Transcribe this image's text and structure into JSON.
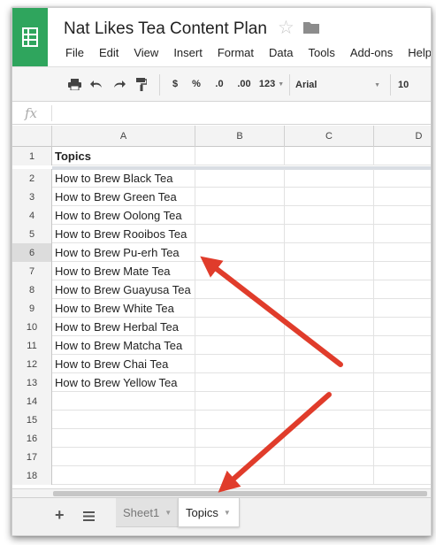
{
  "header": {
    "title": "Nat Likes Tea Content Plan",
    "menu": [
      "File",
      "Edit",
      "View",
      "Insert",
      "Format",
      "Data",
      "Tools",
      "Add-ons",
      "Help"
    ]
  },
  "toolbar": {
    "currency": "$",
    "percent": "%",
    "decrease_decimals": ".0",
    "increase_decimals": ".00",
    "more_formats": "123",
    "font": "Arial",
    "font_size": "10"
  },
  "formula_bar": {
    "fx": "fx",
    "value": ""
  },
  "grid": {
    "columns": [
      "A",
      "B",
      "C",
      "D"
    ],
    "rows": [
      {
        "num": "1",
        "a": "Topics"
      },
      {
        "num": "2",
        "a": "How to Brew Black Tea"
      },
      {
        "num": "3",
        "a": "How to Brew Green Tea"
      },
      {
        "num": "4",
        "a": "How to Brew Oolong Tea"
      },
      {
        "num": "5",
        "a": "How to Brew Rooibos Tea"
      },
      {
        "num": "6",
        "a": "How to Brew Pu-erh Tea"
      },
      {
        "num": "7",
        "a": "How to Brew Mate Tea"
      },
      {
        "num": "8",
        "a": "How to Brew Guayusa Tea"
      },
      {
        "num": "9",
        "a": "How to Brew White Tea"
      },
      {
        "num": "10",
        "a": "How to Brew Herbal Tea"
      },
      {
        "num": "11",
        "a": "How to Brew Matcha Tea"
      },
      {
        "num": "12",
        "a": "How to Brew Chai Tea"
      },
      {
        "num": "13",
        "a": "How to Brew Yellow Tea"
      },
      {
        "num": "14",
        "a": ""
      },
      {
        "num": "15",
        "a": ""
      },
      {
        "num": "16",
        "a": ""
      },
      {
        "num": "17",
        "a": ""
      },
      {
        "num": "18",
        "a": ""
      }
    ]
  },
  "sheets": {
    "tabs": [
      {
        "label": "Sheet1",
        "active": false
      },
      {
        "label": "Topics",
        "active": true
      }
    ]
  },
  "colors": {
    "brand": "#2fa55d",
    "annotation_arrow": "#e03c2b"
  },
  "icons": [
    "sheets-logo-icon",
    "star-icon",
    "folder-icon",
    "print-icon",
    "undo-icon",
    "redo-icon",
    "paint-format-icon",
    "fx-icon",
    "add-sheet-icon",
    "all-sheets-icon"
  ]
}
